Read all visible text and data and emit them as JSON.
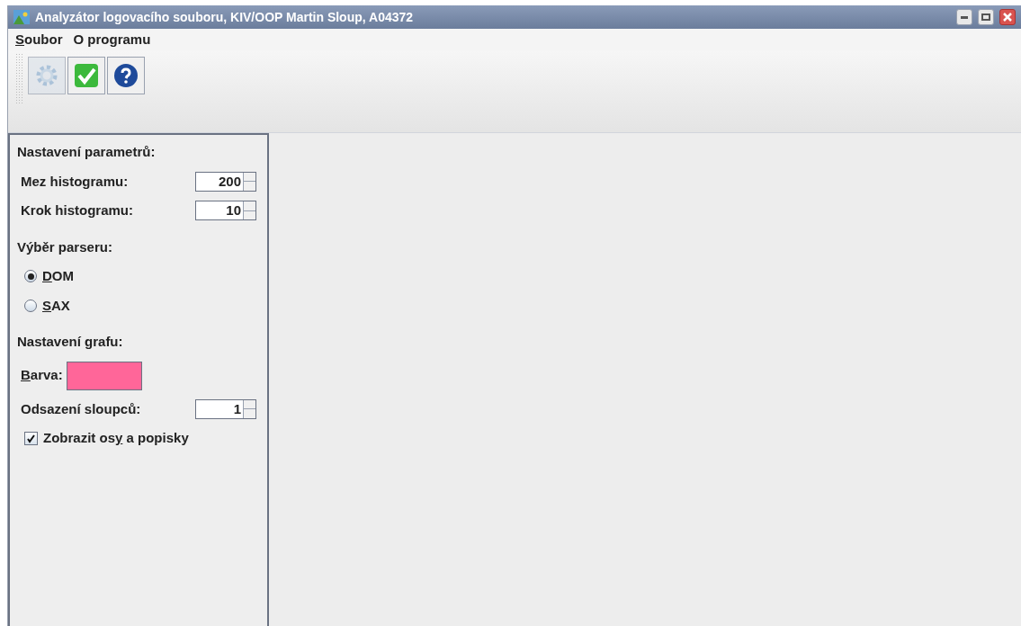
{
  "window": {
    "title": "Analyzátor logovacího souboru, KIV/OOP Martin Sloup, A04372"
  },
  "menu": [
    {
      "key": "S",
      "after": "oubor"
    },
    {
      "before": "O programu"
    }
  ],
  "toolbar": [
    {
      "kind": "gear",
      "disabled": true
    },
    {
      "kind": "check",
      "disabled": false
    },
    {
      "kind": "help",
      "disabled": false
    }
  ],
  "settings": {
    "parameters_heading": "Nastavení parametrů:",
    "spinners": [
      {
        "label": "Mez histogramu:",
        "value": "200"
      },
      {
        "label": "Krok histogramu:",
        "value": "10"
      }
    ],
    "parser_heading": "Výběr parseru:",
    "parsers": [
      {
        "key": "D",
        "after": "OM",
        "selected": true
      },
      {
        "key": "S",
        "after": "AX",
        "selected": false
      }
    ],
    "graph_heading": "Nastavení grafu:",
    "color_label": {
      "key": "B",
      "after": "arva:"
    },
    "color": "#ff6699",
    "offset": {
      "label": "Odsazení sloupců:",
      "value": "1"
    },
    "axes": {
      "before": "Zobrazit os",
      "key": "y",
      "after": " a popisky",
      "checked": true
    }
  }
}
